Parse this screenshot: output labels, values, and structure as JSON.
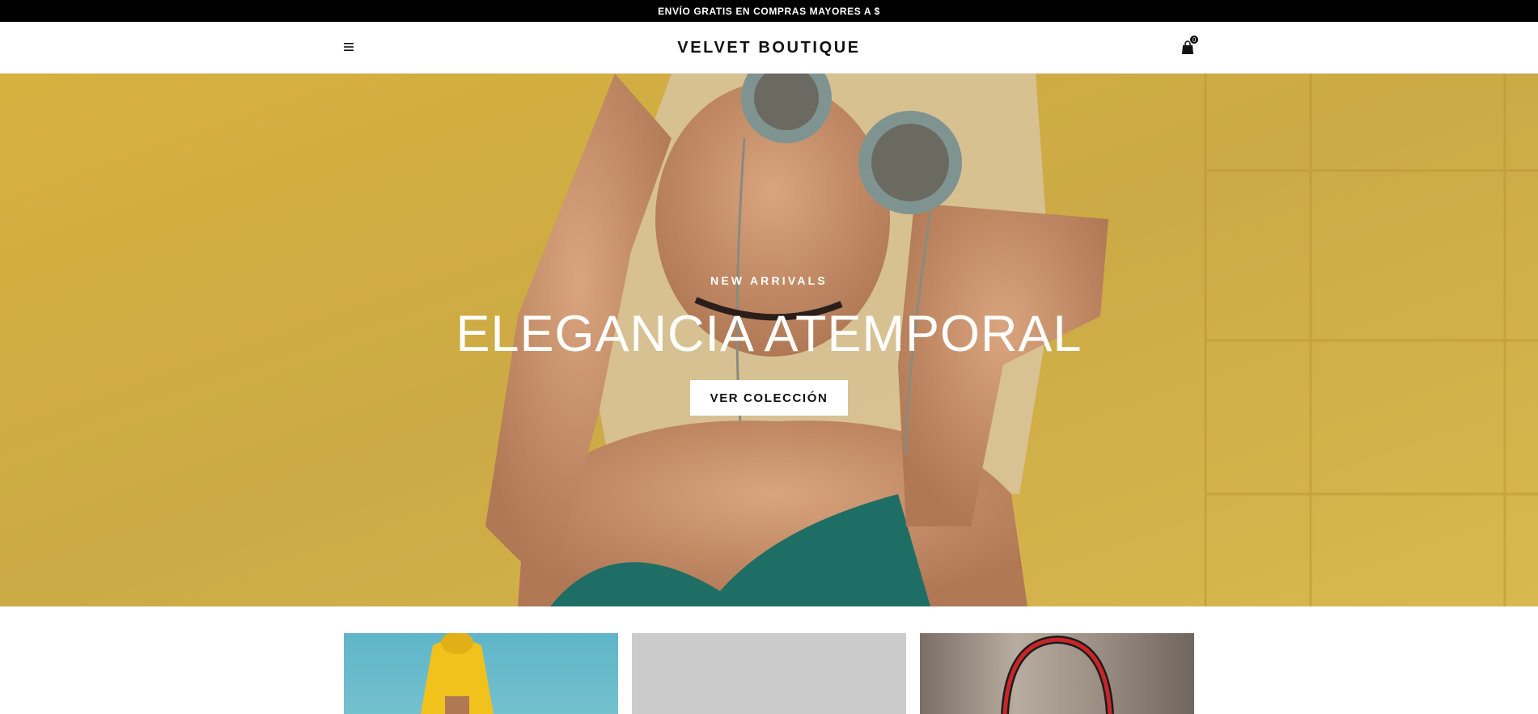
{
  "announcement": {
    "text": "ENVÍO GRATIS EN COMPRAS MAYORES A $"
  },
  "header": {
    "logo": "VELVET BOUTIQUE",
    "menu_icon": "hamburger-menu-icon",
    "cart_icon": "shopping-bag-icon",
    "cart_count": "0"
  },
  "hero": {
    "eyebrow": "NEW ARRIVALS",
    "title": "ELEGANCIA ATEMPORAL",
    "cta_label": "VER COLECCIÓN"
  },
  "collections": {
    "cards": [
      {
        "image": "model-yellow-hoodie-photo"
      },
      {
        "image": "placeholder-image"
      },
      {
        "image": "red-handbag-photo"
      }
    ]
  },
  "colors": {
    "announcement_bg": "#000000",
    "hero_bg": "#d4b044",
    "button_bg": "#ffffff",
    "text_dark": "#111111"
  }
}
